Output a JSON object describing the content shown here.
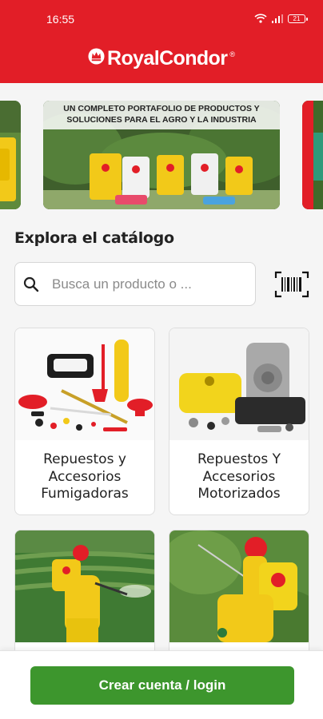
{
  "status_bar": {
    "time": "16:55",
    "battery": "21"
  },
  "header": {
    "brand_name": "RoyalCondor",
    "brand_mark": "®"
  },
  "banner": {
    "text": "Un completo portafolio de productos y soluciones para el agro y la industria"
  },
  "catalog": {
    "title": "Explora el catálogo",
    "search_placeholder": "Busca un producto o ...",
    "categories": [
      {
        "title": "Repuestos y Accesorios Fumigadoras"
      },
      {
        "title": "Repuestos Y Accesorios Motorizados"
      }
    ]
  },
  "footer": {
    "login_label": "Crear cuenta / login"
  },
  "colors": {
    "brand_red": "#e21e27",
    "action_green": "#3d962d",
    "product_yellow": "#f2c919"
  },
  "icons": [
    "wifi-icon",
    "signal-icon",
    "battery-icon",
    "royal-condor-logo-icon",
    "search-icon",
    "barcode-scan-icon"
  ]
}
